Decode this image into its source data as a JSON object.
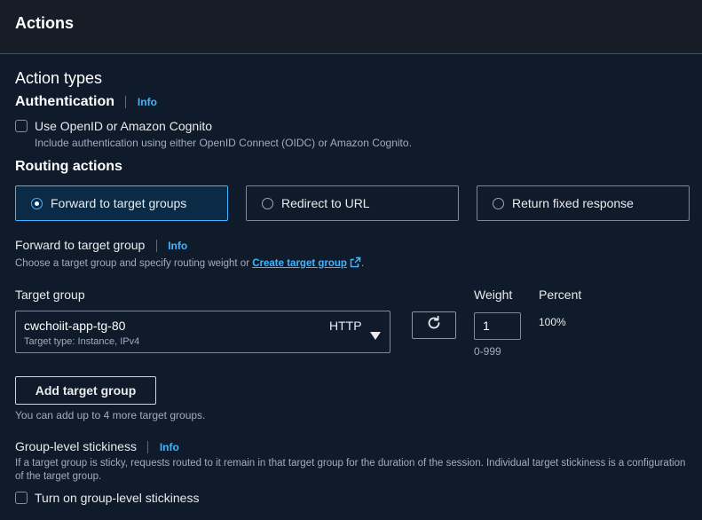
{
  "header": {
    "title": "Actions"
  },
  "action_types": {
    "title": "Action types"
  },
  "authentication": {
    "title": "Authentication",
    "info": "Info",
    "checkbox_label": "Use OpenID or Amazon Cognito",
    "description": "Include authentication using either OpenID Connect (OIDC) or Amazon Cognito.",
    "checked": false
  },
  "routing": {
    "title": "Routing actions",
    "options": [
      {
        "label": "Forward to target groups",
        "selected": true
      },
      {
        "label": "Redirect to URL",
        "selected": false
      },
      {
        "label": "Return fixed response",
        "selected": false
      }
    ]
  },
  "forward": {
    "title": "Forward to target group",
    "info": "Info",
    "description_prefix": "Choose a target group and specify routing weight or",
    "create_link": "Create target group",
    "description_suffix": "."
  },
  "target_group": {
    "label": "Target group",
    "selected_name": "cwchoiit-app-tg-80",
    "selected_protocol": "HTTP",
    "selected_type": "Target type: Instance, IPv4",
    "weight_label": "Weight",
    "weight_value": "1",
    "weight_hint": "0-999",
    "percent_label": "Percent",
    "percent_value": "100%"
  },
  "add_target_group": {
    "button_label": "Add target group",
    "hint": "You can add up to 4 more target groups."
  },
  "stickiness": {
    "title": "Group-level stickiness",
    "info": "Info",
    "description": "If a target group is sticky, requests routed to it remain in that target group for the duration of the session. Individual target stickiness is a configuration of the target group.",
    "checkbox_label": "Turn on group-level stickiness",
    "checked": false
  },
  "colors": {
    "background": "#0f1b2a",
    "header_bg": "#161d26",
    "accent": "#42b4ff",
    "selected_tile_bg": "#0b2a45"
  }
}
